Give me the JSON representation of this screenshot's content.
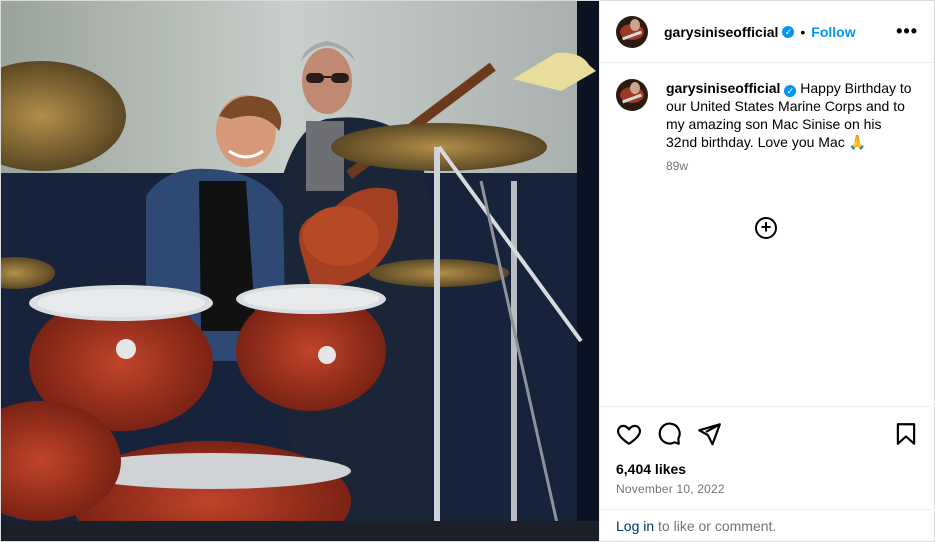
{
  "post": {
    "username": "garysiniseofficial",
    "verified_mark": "✓",
    "separator": "•",
    "follow_label": "Follow",
    "more_label": "•••",
    "caption_username": "garysiniseofficial",
    "caption": "Happy Birthday to our United States Marine Corps and to my amazing son Mac Sinise on his 32nd birthday. Love you Mac",
    "caption_emoji": "🙏",
    "age": "89w",
    "likes": "6,404 likes",
    "date": "November 10, 2022",
    "login_link": "Log in",
    "login_rest": " to like or comment."
  },
  "icons": {
    "like": "heart-icon",
    "comment": "comment-icon",
    "share": "paper-plane-icon",
    "save": "bookmark-icon",
    "more_comments": "plus-circle-icon"
  },
  "colors": {
    "accent": "#0095f6",
    "muted": "#737373",
    "link": "#00376b",
    "border": "#dbdbdb"
  }
}
